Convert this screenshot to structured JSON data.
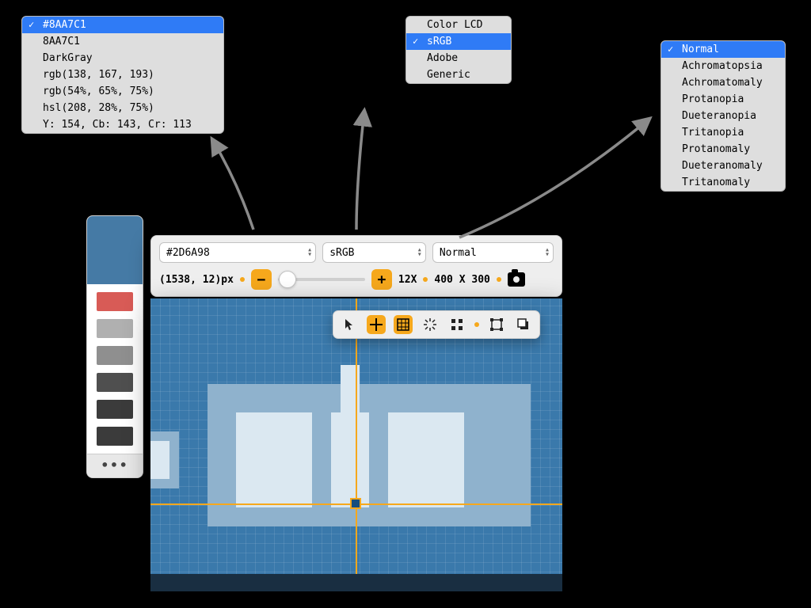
{
  "popups": {
    "color_format": {
      "items": [
        "#8AA7C1",
        "8AA7C1",
        "DarkGray",
        "rgb(138, 167, 193)",
        "rgb(54%, 65%, 75%)",
        "hsl(208, 28%, 75%)",
        "Y: 154, Cb: 143, Cr: 113"
      ],
      "selected_index": 0
    },
    "color_profile": {
      "items": [
        "Color LCD",
        "sRGB",
        "Adobe",
        "Generic"
      ],
      "selected_index": 1
    },
    "color_vision": {
      "items": [
        "Normal",
        "Achromatopsia",
        "Achromatomaly",
        "Protanopia",
        "Dueteranopia",
        "Tritanopia",
        "Protanomaly",
        "Dueteranomaly",
        "Tritanomaly"
      ],
      "selected_index": 0
    }
  },
  "toolbar": {
    "color_value": "#2D6A98",
    "profile_value": "sRGB",
    "vision_value": "Normal",
    "coord_label": "(1538, 12)px",
    "zoom_label": "12X",
    "size_label": "400 X 300",
    "minus": "−",
    "plus": "+"
  },
  "swatches": {
    "current": "#457aa5",
    "history": [
      "#d85b56",
      "#b0b0b0",
      "#8f8f8f",
      "#4f4f4f",
      "#3b3b3b",
      "#3b3b3b"
    ]
  },
  "colors": {
    "accent": "#f6a81c",
    "canvas_bg": "#3a79ab"
  }
}
